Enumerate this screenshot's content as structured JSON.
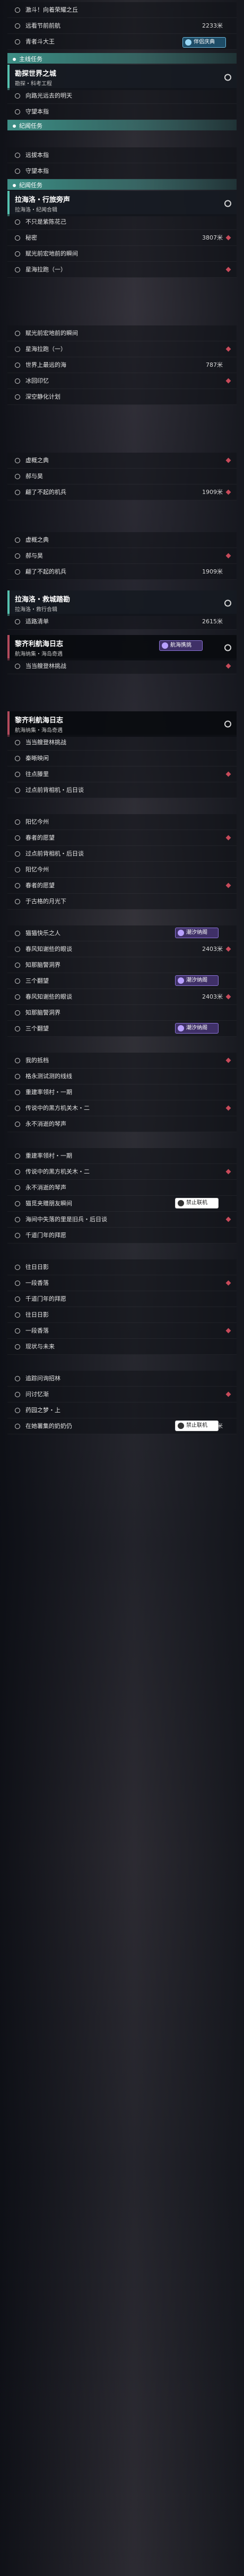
{
  "rows_top": [
    {
      "label": "激斗！向着荣耀之丘",
      "dist": ""
    },
    {
      "label": "远看节前前航",
      "dist": "2233米"
    },
    {
      "label": "青者斗大王",
      "dist": ""
    }
  ],
  "badge_top": "伴侣庆典",
  "cat_main": "主线任务",
  "section_1": {
    "title": "勘探世界之城",
    "sub": "勘探・科考工程"
  },
  "rows_1": [
    "向路光远去的明天",
    "守望本指"
  ],
  "cat_side_1": "纪闻任务",
  "rows_1b": [
    "远拔本指",
    "守望本指"
  ],
  "cat_side_2": "纪闻任务",
  "section_2": {
    "title": "拉海洛・行旅旁声",
    "sub": "拉海洛・纪闻合辑"
  },
  "rows_2": [
    {
      "label": "不只是紫陈花己",
      "dist": ""
    },
    {
      "label": "秘密",
      "dist": "3807米"
    },
    {
      "label": "赋光前宏地前的瞬间",
      "dist": ""
    },
    {
      "label": "星海拉跑（一）",
      "dist": ""
    },
    {
      "label": "赋光前宏地前的瞬间",
      "dist": ""
    },
    {
      "label": "星海拉跑（一）",
      "dist": ""
    },
    {
      "label": "世界上最远的海",
      "dist": "787米"
    },
    {
      "label": "冰回印忆",
      "dist": ""
    },
    {
      "label": "深空静化计划",
      "dist": ""
    },
    {
      "label": "虚概之典",
      "dist": ""
    },
    {
      "label": "郝与昊",
      "dist": ""
    },
    {
      "label": "翩了不起的机兵",
      "dist": "1909米"
    },
    {
      "label": "虚概之典",
      "dist": ""
    },
    {
      "label": "郝与昊",
      "dist": ""
    },
    {
      "label": "翩了不起的机兵",
      "dist": "1909米"
    }
  ],
  "section_3": {
    "title": "拉海洛・救城踏勘",
    "sub": "拉海洛・救行合辑"
  },
  "rows_3": [
    {
      "label": "适路清单",
      "dist": "2615米"
    }
  ],
  "section_4": {
    "title": "黎齐利航海日志",
    "sub": "航海纳集・海岛奇遇"
  },
  "badge_4": "航海携挑",
  "rows_4": [
    "当当艘登林挑战"
  ],
  "section_5": {
    "title": "黎齐利航海日志",
    "sub": "航海纳集・海岛奇遇"
  },
  "rows_5": [
    {
      "label": "当当艘登林挑战",
      "dist": ""
    },
    {
      "label": "秦晰映闲",
      "dist": ""
    },
    {
      "label": "往点滕里",
      "dist": ""
    },
    {
      "label": "过点前背相机・后日谈",
      "dist": ""
    },
    {
      "label": "阳忆今州",
      "dist": ""
    },
    {
      "label": "春者的愿望",
      "dist": ""
    },
    {
      "label": "过点前背相机・后日谈",
      "dist": ""
    },
    {
      "label": "阳忆今州",
      "dist": ""
    },
    {
      "label": "春者的愿望",
      "dist": ""
    },
    {
      "label": "于古格的月光下",
      "dist": ""
    },
    {
      "label": "猫猫快乐之人",
      "dist": ""
    },
    {
      "label": "春风知谢些的眼谈",
      "dist": "2403米"
    },
    {
      "label": "知那脑警洞界",
      "dist": ""
    },
    {
      "label": "三个翻望",
      "dist": ""
    },
    {
      "label": "春风知谢些的眼谈",
      "dist": "2403米"
    },
    {
      "label": "知那脑警洞界",
      "dist": ""
    },
    {
      "label": "三个翻望",
      "dist": ""
    },
    {
      "label": "我的抵档",
      "dist": ""
    },
    {
      "label": "格永测试测的线线",
      "dist": ""
    },
    {
      "label": "重建率领村・一期",
      "dist": ""
    },
    {
      "label": "传说中的黑方机关木・二",
      "dist": ""
    },
    {
      "label": "永不消逝的琴声",
      "dist": ""
    },
    {
      "label": "重建率领村・一期",
      "dist": ""
    },
    {
      "label": "传说中的黑方机关木・二",
      "dist": ""
    },
    {
      "label": "永不消逝的琴声",
      "dist": ""
    },
    {
      "label": "猫觅夹赠朋友瞬间",
      "dist": ""
    },
    {
      "label": "海间中失落的里是旧兵・后日谈",
      "dist": ""
    },
    {
      "label": "千道门年的拜愿",
      "dist": ""
    },
    {
      "label": "往日日影",
      "dist": ""
    },
    {
      "label": "一段香落",
      "dist": ""
    },
    {
      "label": "千道门年的拜愿",
      "dist": ""
    },
    {
      "label": "往日日影",
      "dist": ""
    },
    {
      "label": "一段香落",
      "dist": ""
    },
    {
      "label": "现状与未来",
      "dist": ""
    },
    {
      "label": "追踪问询招林",
      "dist": ""
    },
    {
      "label": "问讨忆渐",
      "dist": ""
    },
    {
      "label": "药园之梦・上",
      "dist": ""
    },
    {
      "label": "在她薯集的奶奶仍",
      "dist": "2135米"
    }
  ],
  "badge_purple": "潮汐纳阁",
  "badge_white": "禁止联机"
}
